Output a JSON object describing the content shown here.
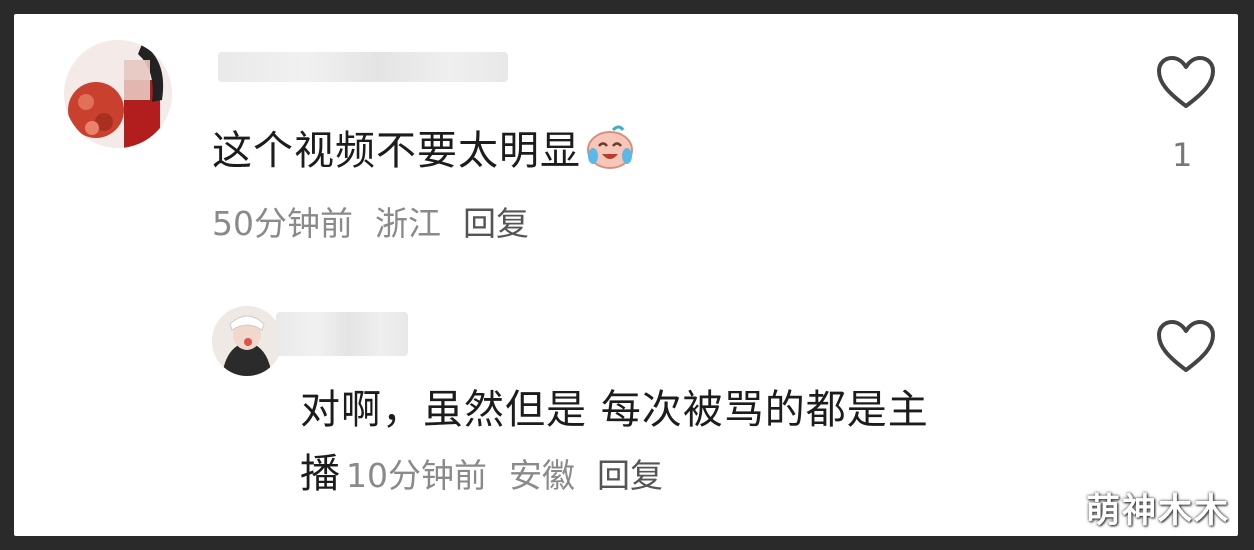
{
  "comments": [
    {
      "text": "这个视频不要太明显",
      "time": "50分钟前",
      "location": "浙江",
      "reply_label": "回复",
      "like_count": "1",
      "emoji": "crying-laughing-emoji"
    },
    {
      "text": "对啊，虽然但是 每次被骂的都是主",
      "text_cont": "播",
      "time": "10分钟前",
      "location": "安徽",
      "reply_label": "回复"
    }
  ],
  "watermark": "萌神木木",
  "colors": {
    "text": "#1c1c1c",
    "meta": "#8a8a8a",
    "heart_stroke": "#444444"
  }
}
